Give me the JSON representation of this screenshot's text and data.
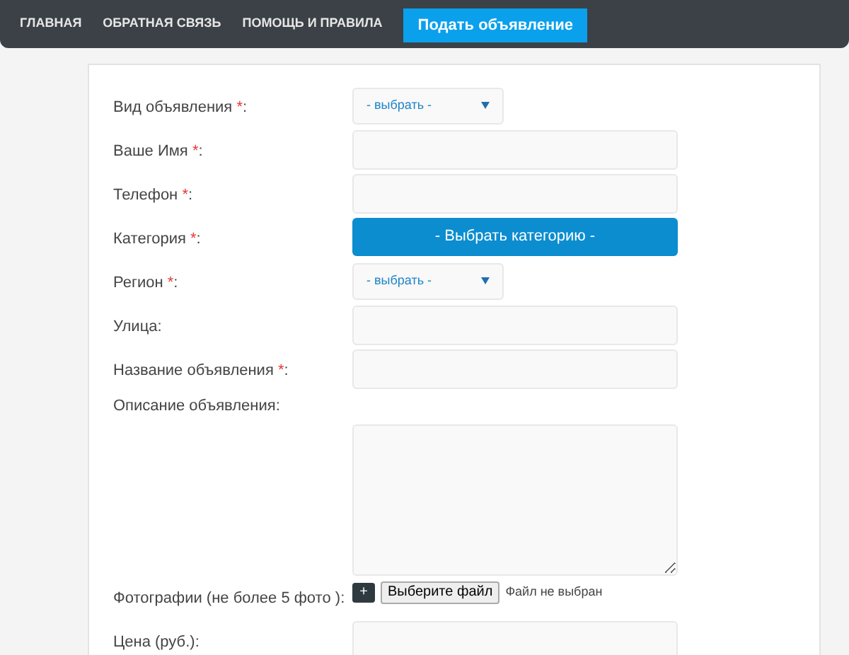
{
  "nav": {
    "items": [
      {
        "label": "ГЛАВНАЯ",
        "selected": false
      },
      {
        "label": "ОБРАТНАЯ СВЯЗЬ",
        "selected": false
      },
      {
        "label": "ПОМОЩЬ И ПРАВИЛА",
        "selected": false
      },
      {
        "label": "Подать объявление",
        "selected": true
      }
    ]
  },
  "form": {
    "fields": [
      {
        "kind": "select",
        "label": "Вид объявления",
        "asterisk": "*",
        "colon": ":",
        "value": "- выбрать -"
      },
      {
        "kind": "text",
        "label": "Ваше Имя",
        "asterisk": "*",
        "colon": ":"
      },
      {
        "kind": "text",
        "label": "Телефон",
        "asterisk": "*",
        "colon": ":"
      },
      {
        "kind": "button",
        "label": "Категория",
        "asterisk": "*",
        "colon": ":",
        "button": "- Выбрать категорию -"
      },
      {
        "kind": "select",
        "label": "Регион",
        "asterisk": "*",
        "colon": ":",
        "value": "- выбрать -"
      },
      {
        "kind": "text",
        "label": "Улица",
        "colon": ":"
      },
      {
        "kind": "text",
        "label": "Название объявления",
        "asterisk": "*",
        "colon": ":"
      },
      {
        "kind": "textarea",
        "label": "Описание объявления",
        "colon": ":"
      },
      {
        "kind": "file",
        "label": "Фотографии (не более 5 фото )",
        "colon": ":",
        "add": "+",
        "button": "Выберите файл",
        "status": "Файл не выбран"
      },
      {
        "kind": "text",
        "label": "Цена (руб.)",
        "colon": ":"
      }
    ]
  }
}
